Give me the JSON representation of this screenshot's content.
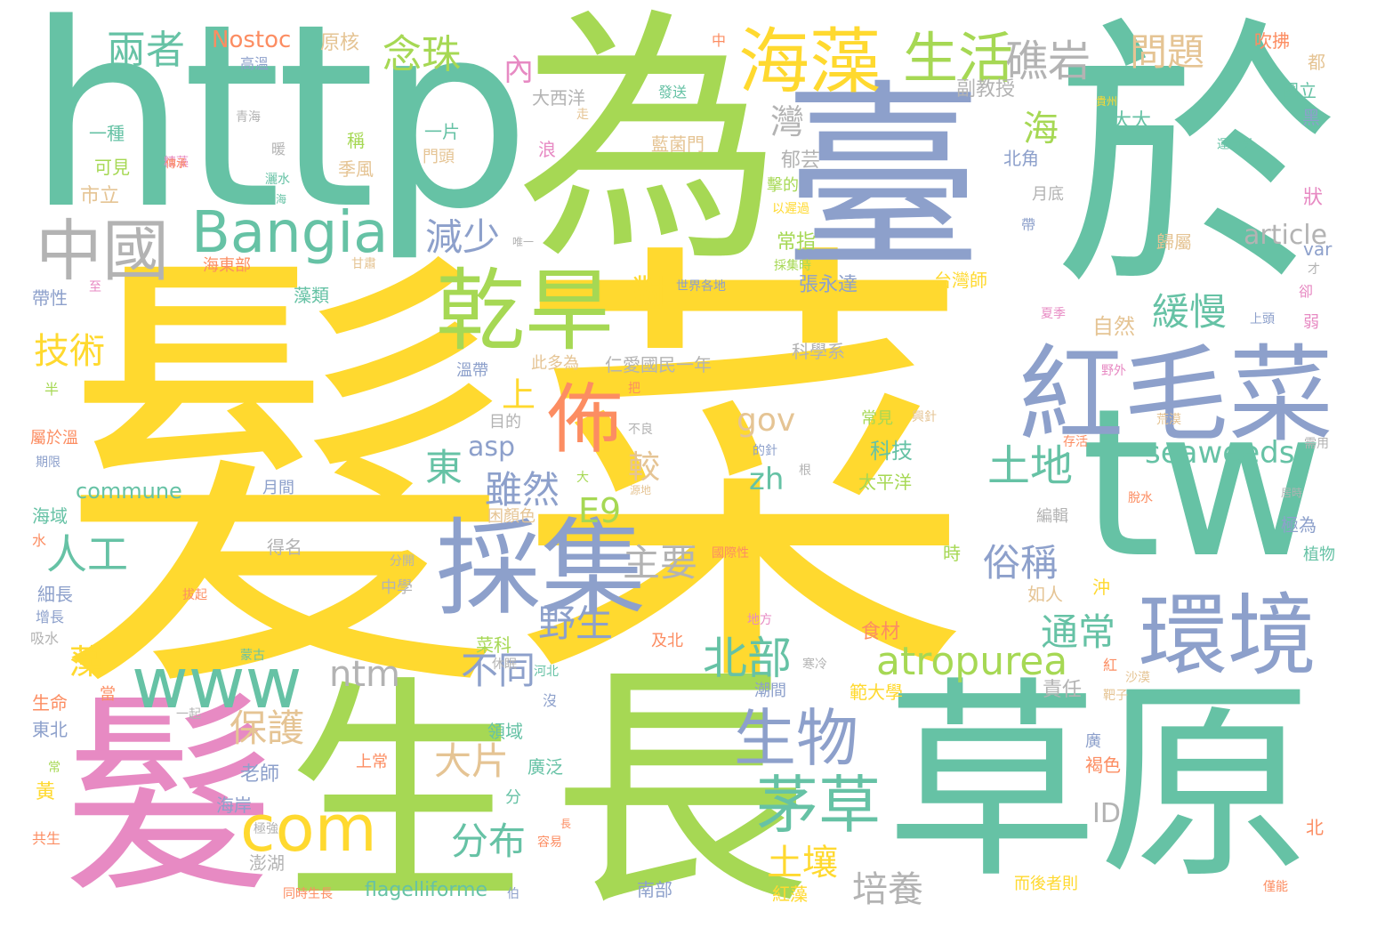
{
  "palette": {
    "yellow": "#ffd92f",
    "green": "#66c2a5",
    "lime": "#a6d854",
    "blue": "#8da0cb",
    "pink": "#e78ac3",
    "orange": "#fc8d62",
    "tan": "#e5c494",
    "gray": "#b3b3b3"
  },
  "words": {
    "w_toufa": "髮",
    "w_cai": "菜",
    "w_http": "http",
    "w_wei": "為",
    "w_tai": "臺",
    "w_yu": "於",
    "w_chang": "長",
    "w_caoyuan": "草原",
    "w_sheng": "生",
    "w_fa2": "髮",
    "w_tw": "tw",
    "w_hongmaocai": "紅毛菜",
    "w_caiji": "採集",
    "w_ganhan": "乾旱",
    "w_huanjing": "環境",
    "w_haizao": "海藻",
    "w_shenghuo": "生活",
    "w_jiaoyan": "礁岩",
    "w_zhongguo": "中國",
    "w_bangia": "Bangia",
    "w_bu": "佈",
    "w_www": "www",
    "w_com": "com",
    "w_shengwu": "生物",
    "w_maocao": "茅草",
    "w_atropurea": "atropurea",
    "w_beibu": "北部",
    "w_tudi": "土地",
    "w_liangzhe": "兩者",
    "w_nianzhu": "念珠",
    "w_nostoc": "Nostoc",
    "w_wenti": "問題",
    "w_jianshao": "減少",
    "w_huanman": "緩慢",
    "w_article": "article",
    "w_jishu": "技術",
    "w_rengong": "人工",
    "w_dong": "東",
    "w_suiran": "雖然",
    "w_zhuyao": "主要",
    "w_suchen": "俗稱",
    "w_tongchang": "通常",
    "w_yesheng": "野生",
    "w_butong": "不同",
    "w_baohu": "保護",
    "w_dapian": "大片",
    "w_fenbu": "分布",
    "w_turang": "土壤",
    "w_peiyang": "培養",
    "w_seaweeds": "seaweeds",
    "w_ntm": "ntm",
    "w_zao": "藻",
    "w_gov": "gov",
    "w_e9": "E9",
    "w_zh": "zh",
    "w_asp": "asp",
    "w_dui": "對",
    "w_shang": "上",
    "w_jiao": "較",
    "w_hai": "海",
    "w_wan": "灣",
    "w_nei": "內",
    "w_id": "ID",
    "w_commune": "commune",
    "w_flagelliforme": "flagelliforme",
    "w_yuanhe": "原核",
    "w_gaowen": "高溫",
    "w_zhong": "中",
    "w_fasong": "發送",
    "w_chuisong": "吹拂",
    "w_du": "都",
    "w_guoli": "國立",
    "w_hei": "黑",
    "w_dada": "大大",
    "w_fujiaoshou": "副教授",
    "w_daxiyang": "大西洋",
    "w_yipian": "一片",
    "w_yizhong": "一種",
    "w_qinghai": "青海",
    "w_cheng": "稱",
    "w_kejian": "可見",
    "w_menjin": "門頭",
    "w_lang": "浪",
    "w_landiemen": "藍菌門",
    "w_beijiao": "北角",
    "w_jifeng": "季風",
    "w_yuyun": "郁芸",
    "w_shili": "市立",
    "w_jiyue": "擊的",
    "w_yidi": "以遲過",
    "w_changzhi": "常指",
    "w_zhuang": "狀",
    "w_yuedi": "月底",
    "w_guishu": "歸屬",
    "w_var": "var",
    "w_haidongbu": "海東部",
    "w_zaolei": "藻類",
    "w_zhangyongda": "張永達",
    "w_taiwanshi": "台灣師",
    "w_daixing": "帶性",
    "w_ziran": "自然",
    "w_renai": "仁愛國民一年",
    "w_kexuexi": "科學系",
    "w_wendai": "溫帶",
    "w_ciduo": "此多為",
    "w_mudi": "目的",
    "w_changjian": "常見",
    "w_keji": "科技",
    "w_shuyuwen": "屬於溫",
    "w_taipingyang": "太平洋",
    "w_kunyanse": "困顏色",
    "w_yuejian": "月間",
    "w_zhongxue": "中學",
    "w_xichang": "細長",
    "w_haiyu": "海域",
    "w_deming": "得名",
    "w_shicai": "食材",
    "w_ruren": "如人",
    "w_caike": "菜科",
    "w_ji": "及北",
    "w_fandaxue": "範大學",
    "w_zeren": "責任",
    "w_lingyu": "領域",
    "w_guangfan": "廣泛",
    "w_shengming": "生命",
    "w_dongbei": "東北",
    "w_laoshi": "老師",
    "w_haian": "海岸",
    "w_huang": "黃",
    "w_penghu": "澎湖",
    "w_nanbu": "南部",
    "w_hongzao": "紅藻",
    "w_erhou": "而後者則",
    "w_hese": "褐色",
    "w_guang": "廣",
    "w_bei": "北",
    "w_jidu": "極為",
    "w_bianji": "編輯",
    "w_zhiwu": "植物",
    "w_gongsheng": "共生",
    "w_shangchang": "上常",
    "w_fen": "分",
    "w_chong": "沖",
    "w_hong": "紅",
    "w_shi": "時",
    "w_dai": "帶",
    "w_ban": "半",
    "w_xishui": "吸水",
    "w_shui": "水",
    "w_zengzhang": "增長",
    "w_qixian": "期限",
    "w_dangyi": "當",
    "w_chang2": "常",
    "w_chuanmin": "傳承",
    "w_weiyi": "唯一",
    "w_xiushui": "休眠",
    "w_yuandi": "源地",
    "w_ye": "野外",
    "w_ba": "把",
    "w_buliang": "不良",
    "w_gen": "根",
    "w_cunhuo": "存活",
    "w_huangmo": "荒漠",
    "w_xuyong": "需用",
    "w_tuoshui": "脫水",
    "w_shamo": "沙漠",
    "w_ruoyu": "弱",
    "w_jushi": "居時",
    "w_quemei": "卻",
    "w_shangtou": "上頭",
    "w_shijiegedi": "世界各地",
    "w_caijishi": "採集時",
    "w_ganzhu": "甘肅",
    "w_guojixing": "國際性",
    "w_difang": "地方",
    "w_hanlengde": "寒冷",
    "w_chaojian": "潮間",
    "w_bazi": "靶子",
    "w_tongsheng": "同時生長",
    "w_jiqiang": "極強",
    "w_menggu": "蒙古",
    "w_hebei": "河北",
    "w_mei": "沒",
    "w_yijian": "一起",
    "w_bai": "伯",
    "w_bazhi": "拔起",
    "w_fenkai": "分開",
    "w_shuizhen": "運同針",
    "w_zou": "走",
    "w_xingjian": "興針",
    "w_dezhen": "的針",
    "w_da": "大",
    "w_yuyan": "暖",
    "w_rongyi": "容易",
    "w_qiangjin": "僅能",
    "w_zhangshang": "長",
    "w_xiaxia": "夏季",
    "w_cai2": "才",
    "w_zhonghai": "青海",
    "w_gaoyuan": "貴州",
    "w_shuishui": "灑水",
    "w_qingzao": "精藻",
    "w_shizhe": "至"
  }
}
